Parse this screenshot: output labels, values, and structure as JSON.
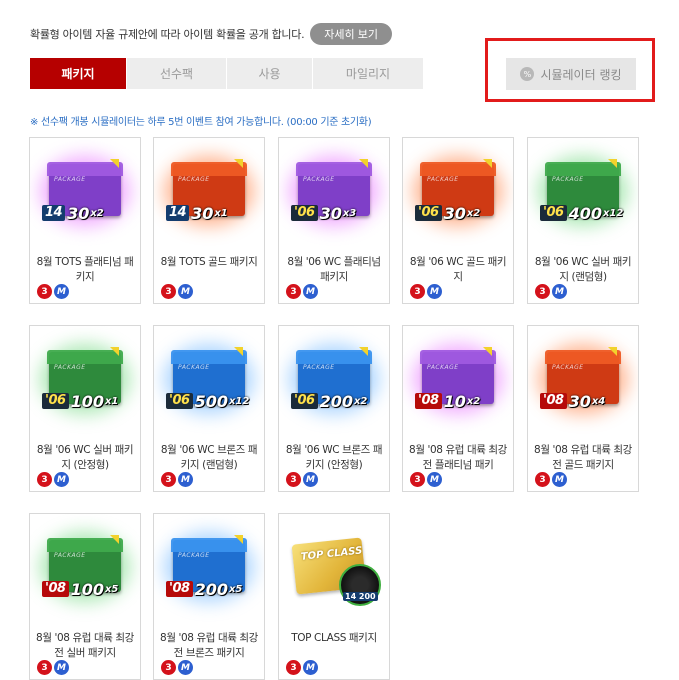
{
  "notice": {
    "text": "확률형 아이템 자율 규제안에 따라 아이템 확률을 공개 합니다.",
    "detail_button": "자세히 보기"
  },
  "tabs": [
    {
      "label": "패키지",
      "active": true
    },
    {
      "label": "선수팩",
      "active": false
    },
    {
      "label": "사용",
      "active": false
    },
    {
      "label": "마일리지",
      "active": false
    }
  ],
  "simulator_button": {
    "label": "시뮬레이터 랭킹",
    "icon": "percent-coin-icon"
  },
  "info_text": "※ 선수팩 개봉 시뮬레이터는 하루 5번 이벤트 참여 가능합니다. (00:00 기준 초기화)",
  "colors": {
    "accent": "#b60000",
    "highlight_box": "#e21b1b",
    "info_text": "#2c6fc4"
  },
  "items": [
    {
      "title": "8월 TOTS 플래티넘 패키지",
      "year": "14",
      "qty": "30",
      "mult": "x2",
      "color": "purple"
    },
    {
      "title": "8월 TOTS 골드 패키지",
      "year": "14",
      "qty": "30",
      "mult": "x1",
      "color": "red"
    },
    {
      "title": "8월 '06 WC 플래티넘 패키지",
      "year": "06",
      "qty": "30",
      "mult": "x3",
      "color": "purple"
    },
    {
      "title": "8월 '06 WC 골드 패키지",
      "year": "06",
      "qty": "30",
      "mult": "x2",
      "color": "red"
    },
    {
      "title": "8월 '06 WC 실버 패키지 (랜덤형)",
      "year": "06",
      "qty": "400",
      "mult": "x12",
      "color": "green"
    },
    {
      "title": "8월 '06 WC 실버 패키지 (안정형)",
      "year": "06",
      "qty": "100",
      "mult": "x1",
      "color": "green"
    },
    {
      "title": "8월 '06 WC 브론즈 패키지 (랜덤형)",
      "year": "06",
      "qty": "500",
      "mult": "x12",
      "color": "blue"
    },
    {
      "title": "8월 '06 WC 브론즈 패키지 (안정형)",
      "year": "06",
      "qty": "200",
      "mult": "x2",
      "color": "blue"
    },
    {
      "title": "8월 '08 유럽 대륙 최강전 플래티넘 패키",
      "year": "08",
      "qty": "10",
      "mult": "x2",
      "color": "purple"
    },
    {
      "title": "8월 '08 유럽 대륙 최강전 골드 패키지",
      "year": "08",
      "qty": "30",
      "mult": "x4",
      "color": "red"
    },
    {
      "title": "8월 '08 유럽 대륙 최강전 실버 패키지",
      "year": "08",
      "qty": "100",
      "mult": "x5",
      "color": "green"
    },
    {
      "title": "8월 '08 유럽 대륙 최강전 브론즈 패키지",
      "year": "08",
      "qty": "200",
      "mult": "x5",
      "color": "blue"
    },
    {
      "title": "TOP CLASS 패키지",
      "year": "14",
      "qty": "200",
      "mult": "",
      "color": "gold",
      "special": "TOP CLASS"
    }
  ],
  "item_icons": {
    "limit": "3",
    "currency": "M"
  }
}
